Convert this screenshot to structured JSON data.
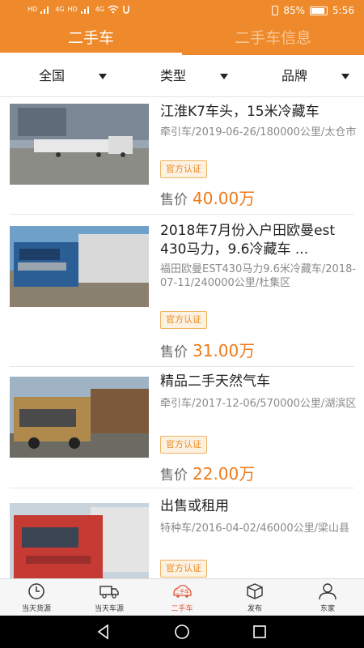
{
  "status_bar": {
    "network_left": [
      "HD",
      "4G",
      "HD",
      "4G"
    ],
    "battery": "85%",
    "time": "5:56"
  },
  "top_tabs": [
    {
      "label": "二手车",
      "active": true
    },
    {
      "label": "二手车信息",
      "active": false
    }
  ],
  "filters": [
    {
      "label": "全国"
    },
    {
      "label": "类型"
    },
    {
      "label": "品牌"
    }
  ],
  "listings": [
    {
      "title": "江淮K7车头，15米冷藏车",
      "meta": "牵引车/2019-06-26/180000公里/太仓市",
      "badge": "官方认证",
      "price_label": "售价",
      "price": "40.00万"
    },
    {
      "title": "2018年7月份入户田欧曼est 430马力，9.6冷藏车 ...",
      "meta": "福田欧曼EST430马力9.6米冷藏车/2018-07-11/240000公里/杜集区",
      "badge": "官方认证",
      "price_label": "售价",
      "price": "31.00万"
    },
    {
      "title": "精品二手天然气车",
      "meta": "牵引车/2017-12-06/570000公里/湖滨区",
      "badge": "官方认证",
      "price_label": "售价",
      "price": "22.00万"
    },
    {
      "title": "出售或租用",
      "meta": "特种车/2016-04-02/46000公里/梁山县",
      "badge": "官方认证"
    }
  ],
  "bottom_nav": [
    {
      "label": "当天货源",
      "icon": "clock-icon",
      "active": false
    },
    {
      "label": "当天车源",
      "icon": "truck-icon",
      "active": false
    },
    {
      "label": "二手车",
      "icon": "used-car-icon",
      "active": true,
      "icon_text": "二手车"
    },
    {
      "label": "发布",
      "icon": "box-icon",
      "active": false
    },
    {
      "label": "东家",
      "icon": "person-icon",
      "active": false
    }
  ],
  "colors": {
    "brand": "#ee8a2b",
    "price": "#ee7a1a",
    "active_nav": "#e2573a"
  }
}
